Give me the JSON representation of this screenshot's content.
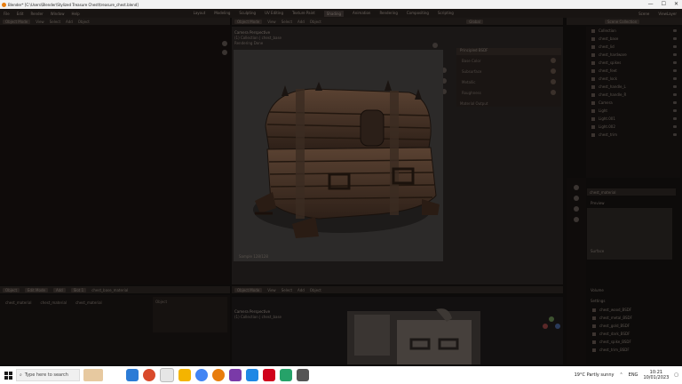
{
  "titlebar": {
    "title": "Blender* [C:\\Users\\Blender\\Stylized Treasure Chest\\treasure_chest.blend]",
    "min": "—",
    "max": "☐",
    "close": "✕"
  },
  "menubar": {
    "items": [
      "File",
      "Edit",
      "Render",
      "Window",
      "Help"
    ],
    "workspaces": [
      "Layout",
      "Modeling",
      "Sculpting",
      "UV Editing",
      "Texture Paint",
      "Shading",
      "Animation",
      "Rendering",
      "Compositing",
      "Scripting"
    ],
    "active_workspace": "Shading",
    "scene_label": "Scene",
    "view_layer_label": "ViewLayer"
  },
  "left_editor": {
    "mode": "Object Mode",
    "view": "View",
    "select": "Select",
    "add": "Add",
    "object": "Object"
  },
  "viewport": {
    "mode": "Object Mode",
    "view": "View",
    "select": "Select",
    "add": "Add",
    "object": "Object",
    "overlay_title": "Camera Perspective",
    "overlay_sub": "(1) Collection | chest_base",
    "overlay_sub2": "Rendering Done",
    "corner_label": "Sample 128/128",
    "shading": "Global"
  },
  "node_panel": {
    "title": "Principled BSDF",
    "rows": [
      "Base Color",
      "Subsurface",
      "Metallic",
      "Roughness"
    ],
    "footer": "Material Output"
  },
  "outliner": {
    "header": "Scene Collection",
    "items": [
      "Collection",
      "chest_base",
      "chest_lid",
      "chest_hardware",
      "chest_spikes",
      "chest_feet",
      "chest_lock",
      "chest_handle_L",
      "chest_handle_R",
      "Camera",
      "Light",
      "Light.001",
      "Light.002",
      "chest_trim"
    ]
  },
  "properties": {
    "header": "chest_material",
    "sections": [
      "Preview",
      "Surface",
      "Volume",
      "Settings"
    ],
    "materials": [
      "chest_wood_BSDF",
      "chest_metal_BSDF",
      "chest_gold_BSDF",
      "chest_dark_BSDF",
      "chest_spike_BSDF",
      "chest_trim_BSDF"
    ]
  },
  "bottom_left": {
    "tabs": [
      "Object",
      "Edit Mode",
      "Add"
    ],
    "breadcrumb": [
      "chest_material",
      "chest_material",
      "chest_material"
    ],
    "slot_label": "Slot 1",
    "object_label": "Object",
    "material_name": "chest_base_material"
  },
  "bottom_view": {
    "overlay_title": "Camera Perspective",
    "overlay_sub": "(1) Collection | chest_base"
  },
  "taskbar": {
    "search_placeholder": "Type here to search",
    "weather": "19°C Partly sunny",
    "time": "10:21",
    "date": "10/01/2023",
    "lang": "ENG"
  },
  "colors": {
    "accent": "#e87d0d",
    "taskbar": "#ffffff",
    "app_bg": "#0d0b0a"
  }
}
